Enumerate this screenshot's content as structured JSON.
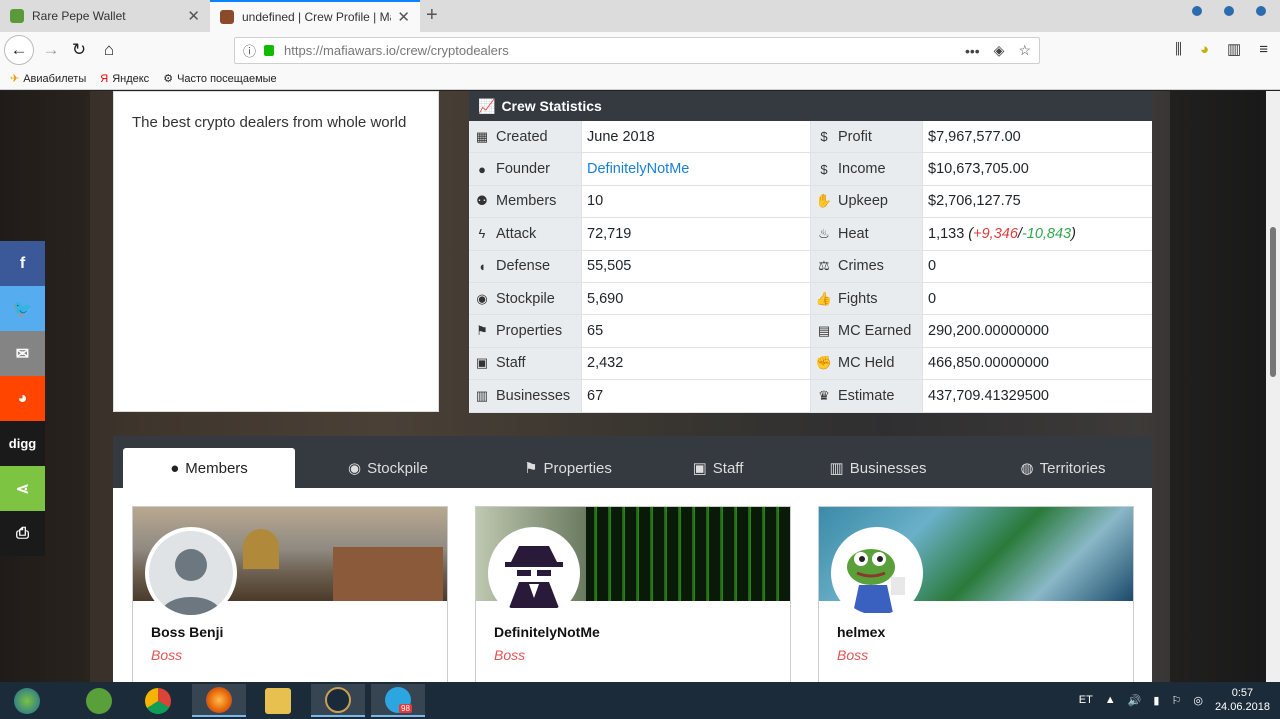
{
  "browser": {
    "tabs": [
      {
        "title": "Rare Pepe Wallet"
      },
      {
        "title": "undefined | Crew Profile | Mafia"
      }
    ],
    "url_main": "https://mafiawars.io",
    "url_path": "/crew/cryptodealers",
    "bookmarks": [
      "Авиабилеты",
      "Яндекс",
      "Часто посещаемые"
    ]
  },
  "crew": {
    "description": "The best crypto dealers from whole world",
    "stats_title": "Crew Statistics",
    "left": [
      {
        "icon": "calendar-icon",
        "glyph": "▦",
        "label": "Created",
        "value": "June 2018"
      },
      {
        "icon": "user-icon",
        "glyph": "●",
        "label": "Founder",
        "value": "DefinitelyNotMe"
      },
      {
        "icon": "users-icon",
        "glyph": "⚉",
        "label": "Members",
        "value": "10"
      },
      {
        "icon": "bolt-icon",
        "glyph": "ϟ",
        "label": "Attack",
        "value": "72,719"
      },
      {
        "icon": "shield-icon",
        "glyph": "◖",
        "label": "Defense",
        "value": "55,505"
      },
      {
        "icon": "piggy-bank-icon",
        "glyph": "◉",
        "label": "Stockpile",
        "value": "5,690"
      },
      {
        "icon": "flag-icon",
        "glyph": "⚑",
        "label": "Properties",
        "value": "65"
      },
      {
        "icon": "id-card-icon",
        "glyph": "▣",
        "label": "Staff",
        "value": "2,432"
      },
      {
        "icon": "building-icon",
        "glyph": "▥",
        "label": "Businesses",
        "value": "67"
      }
    ],
    "right": [
      {
        "icon": "dollar-icon",
        "glyph": "$",
        "label": "Profit",
        "value": "$7,967,577.00"
      },
      {
        "icon": "dollar-icon",
        "glyph": "$",
        "label": "Income",
        "value": "$10,673,705.00"
      },
      {
        "icon": "hand-holding-icon",
        "glyph": "✋",
        "label": "Upkeep",
        "value": "$2,706,127.75"
      },
      {
        "icon": "fire-icon",
        "glyph": "♨",
        "label": "Heat",
        "value": "1,133"
      },
      {
        "icon": "balance-scale-icon",
        "glyph": "⚖",
        "label": "Crimes",
        "value": "0"
      },
      {
        "icon": "thumbs-up-icon",
        "glyph": "👍",
        "label": "Fights",
        "value": "0"
      },
      {
        "icon": "briefcase-icon",
        "glyph": "▤",
        "label": "MC Earned",
        "value": "290,200.00000000"
      },
      {
        "icon": "fist-icon",
        "glyph": "✊",
        "label": "MC Held",
        "value": "466,850.00000000"
      },
      {
        "icon": "trophy-icon",
        "glyph": "♛",
        "label": "Estimate",
        "value": "437,709.41329500"
      }
    ],
    "heat_plus": "+9,346",
    "heat_minus": "-10,843"
  },
  "member_tabs": [
    "Members",
    "Stockpile",
    "Properties",
    "Staff",
    "Businesses",
    "Territories"
  ],
  "members": [
    {
      "name": "Boss Benji",
      "role": "Boss"
    },
    {
      "name": "DefinitelyNotMe",
      "role": "Boss"
    },
    {
      "name": "helmex",
      "role": "Boss"
    }
  ],
  "share": [
    "f",
    "digg"
  ],
  "taskbar": {
    "lang": "ET",
    "time": "0:57",
    "date": "24.06.2018",
    "telegram_badge": "98"
  },
  "colors": {
    "dark_header": "#343a40",
    "link": "#1a7fd4",
    "role": "#e05555",
    "heat_plus": "#e03a3a",
    "heat_minus": "#2fa54a"
  }
}
